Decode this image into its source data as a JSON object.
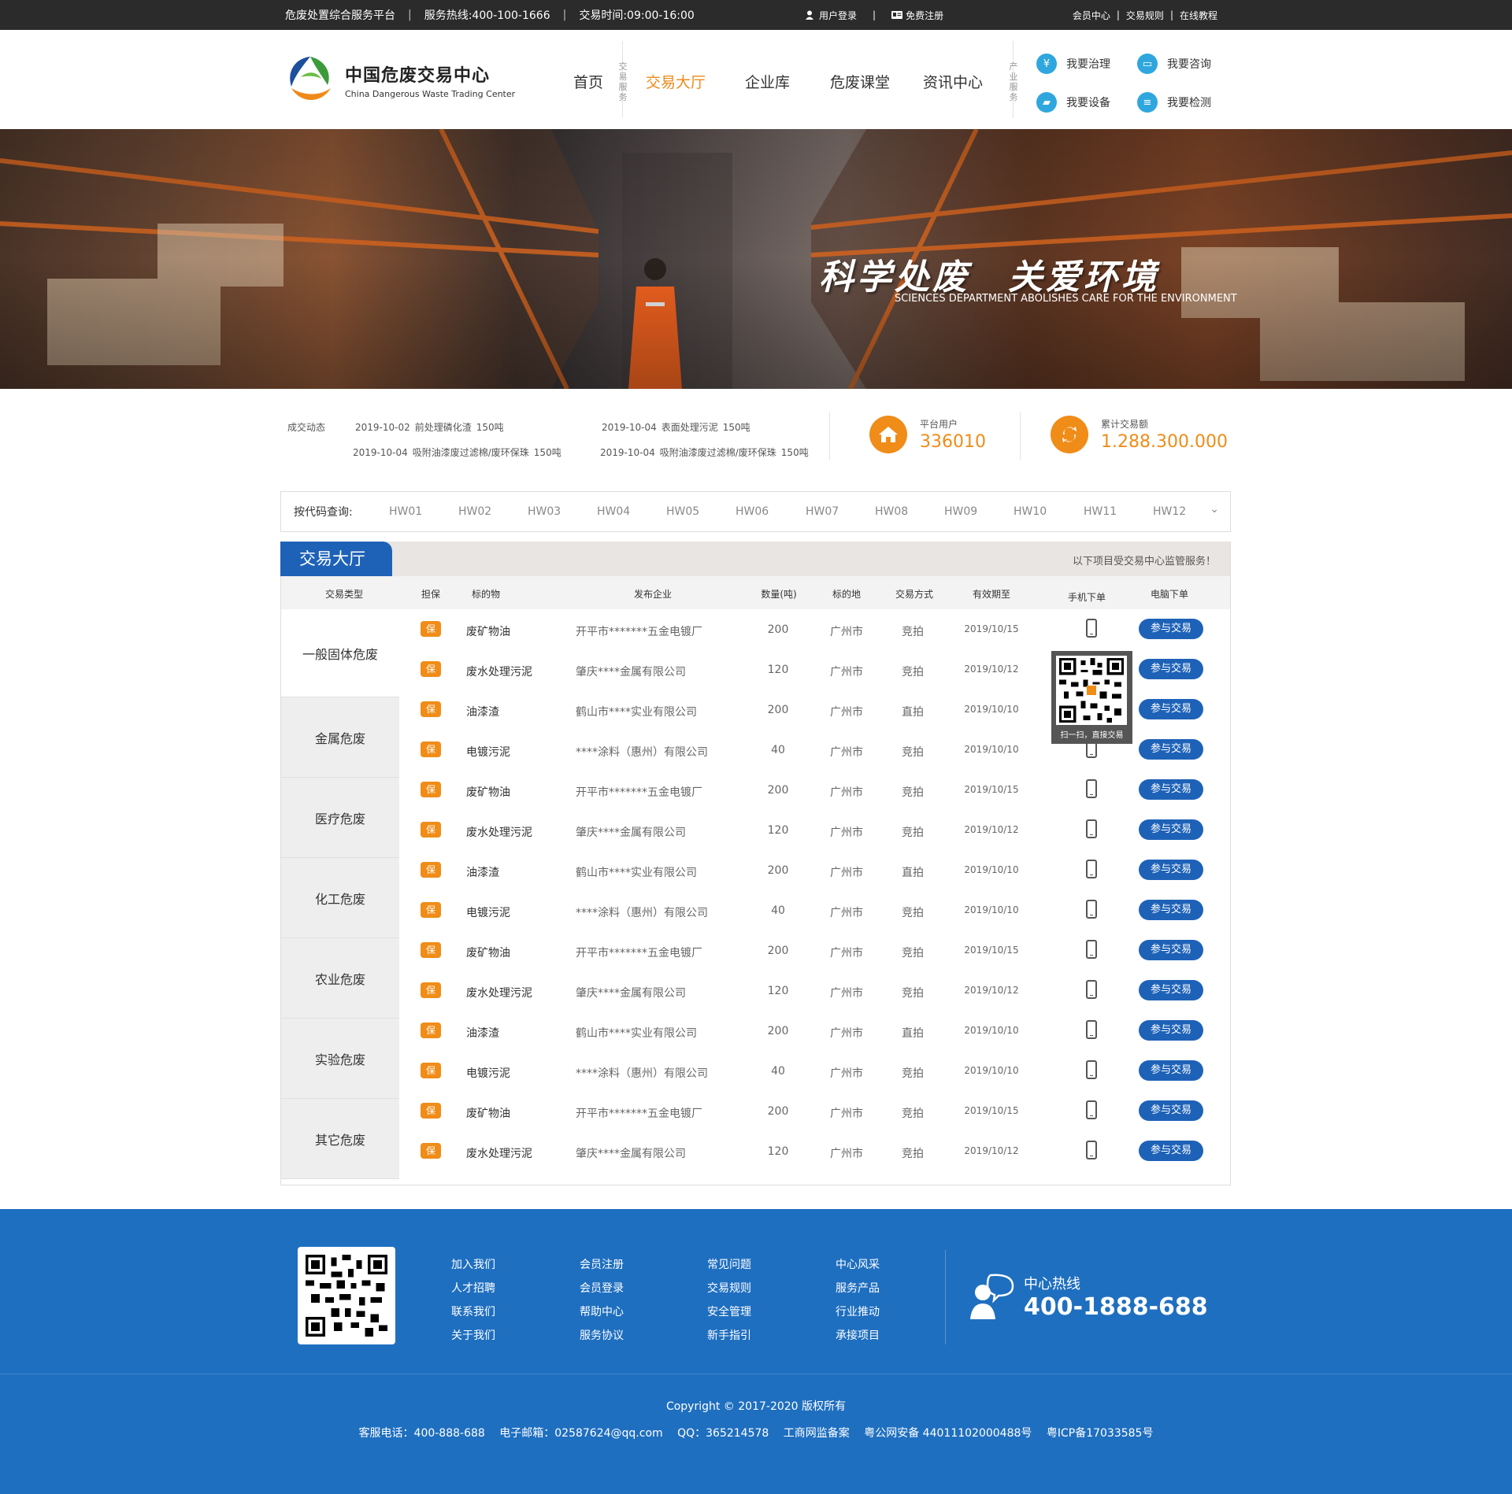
{
  "topbar": {
    "platform": "危废处置综合服务平台",
    "hotline": "服务热线:400-100-1666",
    "hours": "交易时间:09:00-16:00",
    "login": "用户登录",
    "register": "免费注册",
    "links": [
      "会员中心",
      "交易规则",
      "在线教程"
    ]
  },
  "logo": {
    "cn": "中国危废交易中心",
    "en": "China Dangerous Waste Trading Center"
  },
  "nav": {
    "home": "首页",
    "trade_label": "交易服务",
    "items": [
      "交易大厅",
      "企业库",
      "危废课堂",
      "资讯中心"
    ],
    "industry_label": "产业服务"
  },
  "services": [
    "我要治理",
    "我要咨询",
    "我要设备",
    "我要检测"
  ],
  "banner": {
    "title": "科学处废　关爱环境",
    "subtitle": "SCIENCES DEPARTMENT ABOLISHES CARE FOR THE ENVIRONMENT"
  },
  "deals": {
    "label": "成交动态",
    "items": [
      {
        "date": "2019-10-02",
        "name": "前处理磷化渣",
        "qty": "150吨"
      },
      {
        "date": "2019-10-04",
        "name": "表面处理污泥",
        "qty": "150吨"
      },
      {
        "date": "2019-10-04",
        "name": "吸附油漆废过滤棉/废环保珠",
        "qty": "150吨"
      },
      {
        "date": "2019-10-04",
        "name": "吸附油漆废过滤棉/废环保珠",
        "qty": "150吨"
      }
    ]
  },
  "stats": {
    "users_label": "平台用户",
    "users_value": "336010",
    "volume_label": "累计交易额",
    "volume_value": "1.288.300.000"
  },
  "codes": {
    "label": "按代码查询:",
    "items": [
      "HW01",
      "HW02",
      "HW03",
      "HW04",
      "HW05",
      "HW06",
      "HW07",
      "HW08",
      "HW09",
      "HW10",
      "HW11",
      "HW12"
    ]
  },
  "hall": {
    "title": "交易大厅",
    "note": "以下项目受交易中心监管服务！",
    "headers": [
      "交易类型",
      "担保",
      "标的物",
      "发布企业",
      "数量(吨)",
      "标的地",
      "交易方式",
      "有效期至",
      "手机下单",
      "电脑下单"
    ],
    "categories": [
      "一般固体危废",
      "金属危废",
      "医疗危废",
      "化工危废",
      "农业危废",
      "实验危废",
      "其它危废"
    ],
    "bao": "保",
    "join": "参与交易",
    "qr_text": "扫一扫，直接交易",
    "rows": [
      {
        "item": "废矿物油",
        "company": "开平市*******五金电镀厂",
        "qty": "200",
        "place": "广州市",
        "mode": "竞拍",
        "date": "2019/10/15"
      },
      {
        "item": "废水处理污泥",
        "company": "肇庆****金属有限公司",
        "qty": "120",
        "place": "广州市",
        "mode": "竞拍",
        "date": "2019/10/12"
      },
      {
        "item": "油漆渣",
        "company": "鹤山市****实业有限公司",
        "qty": "200",
        "place": "广州市",
        "mode": "直拍",
        "date": "2019/10/10"
      },
      {
        "item": "电镀污泥",
        "company": "****涂料（惠州）有限公司",
        "qty": "40",
        "place": "广州市",
        "mode": "竞拍",
        "date": "2019/10/10"
      },
      {
        "item": "废矿物油",
        "company": "开平市*******五金电镀厂",
        "qty": "200",
        "place": "广州市",
        "mode": "竞拍",
        "date": "2019/10/15"
      },
      {
        "item": "废水处理污泥",
        "company": "肇庆****金属有限公司",
        "qty": "120",
        "place": "广州市",
        "mode": "竞拍",
        "date": "2019/10/12"
      },
      {
        "item": "油漆渣",
        "company": "鹤山市****实业有限公司",
        "qty": "200",
        "place": "广州市",
        "mode": "直拍",
        "date": "2019/10/10"
      },
      {
        "item": "电镀污泥",
        "company": "****涂料（惠州）有限公司",
        "qty": "40",
        "place": "广州市",
        "mode": "竞拍",
        "date": "2019/10/10"
      },
      {
        "item": "废矿物油",
        "company": "开平市*******五金电镀厂",
        "qty": "200",
        "place": "广州市",
        "mode": "竞拍",
        "date": "2019/10/15"
      },
      {
        "item": "废水处理污泥",
        "company": "肇庆****金属有限公司",
        "qty": "120",
        "place": "广州市",
        "mode": "竞拍",
        "date": "2019/10/12"
      },
      {
        "item": "油漆渣",
        "company": "鹤山市****实业有限公司",
        "qty": "200",
        "place": "广州市",
        "mode": "直拍",
        "date": "2019/10/10"
      },
      {
        "item": "电镀污泥",
        "company": "****涂料（惠州）有限公司",
        "qty": "40",
        "place": "广州市",
        "mode": "竞拍",
        "date": "2019/10/10"
      },
      {
        "item": "废矿物油",
        "company": "开平市*******五金电镀厂",
        "qty": "200",
        "place": "广州市",
        "mode": "竞拍",
        "date": "2019/10/15"
      },
      {
        "item": "废水处理污泥",
        "company": "肇庆****金属有限公司",
        "qty": "120",
        "place": "广州市",
        "mode": "竞拍",
        "date": "2019/10/12"
      }
    ]
  },
  "footer": {
    "cols": [
      [
        "加入我们",
        "人才招聘",
        "联系我们",
        "关于我们"
      ],
      [
        "会员注册",
        "会员登录",
        "帮助中心",
        "服务协议"
      ],
      [
        "常见问题",
        "交易规则",
        "安全管理",
        "新手指引"
      ],
      [
        "中心风采",
        "服务产品",
        "行业推动",
        "承接项目"
      ]
    ],
    "hotline_label": "中心热线",
    "hotline_number": "400-1888-688",
    "copyright": "Copyright © 2017-2020  版权所有",
    "info": [
      "客服电话：400-888-688",
      "电子邮箱：02587624@qq.com",
      "QQ：365214578",
      "工商网监备案",
      "粤公网安备 44011102000488号",
      "粤ICP备17033585号"
    ]
  },
  "colors": {
    "accent_orange": "#f08c18",
    "brand_blue": "#1e62b8",
    "footer_blue": "#1f6fc0",
    "topbar": "#2b2b2b"
  }
}
